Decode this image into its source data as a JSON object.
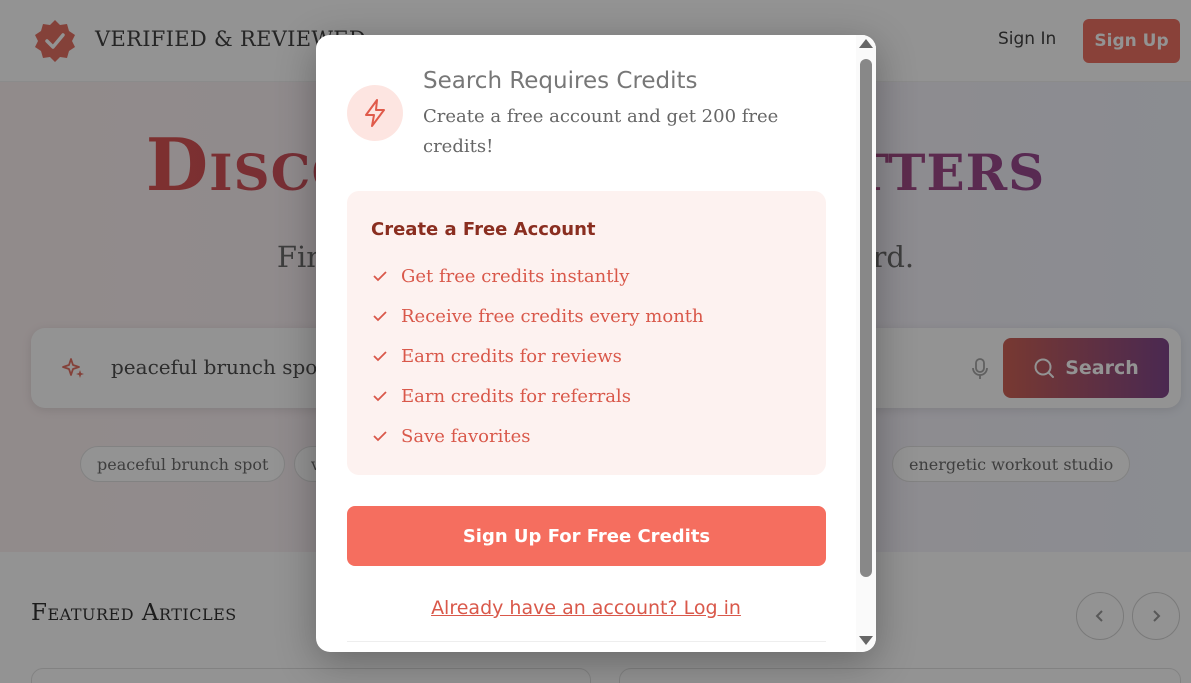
{
  "header": {
    "logo_text": "VERIFIED & REVIEWED",
    "signin_label": "Sign In",
    "signup_label": "Sign Up",
    "brand_color": "#ea5a4a"
  },
  "hero": {
    "title": "Discover What Matters",
    "subtitle": "Find your perfect place with just one word."
  },
  "search": {
    "value": "peaceful brunch spot",
    "button_label": "Search",
    "sparkle_icon": "sparkle-icon",
    "mic_icon": "microphone-icon"
  },
  "chips": [
    "peaceful brunch spot",
    "v",
    "energetic workout studio"
  ],
  "featured": {
    "heading": "Featured Articles"
  },
  "modal": {
    "icon": "lightning-bolt-icon",
    "title": "Search Requires Credits",
    "description": "Create a free account and get 200 free credits!",
    "benefits_title": "Create a Free Account",
    "benefits": [
      "Get free credits instantly",
      "Receive free credits every month",
      "Earn credits for reviews",
      "Earn credits for referrals",
      "Save favorites"
    ],
    "cta_label": "Sign Up For Free Credits",
    "login_label": "Already have an account? Log in",
    "accent_color": "#f56e5f"
  }
}
